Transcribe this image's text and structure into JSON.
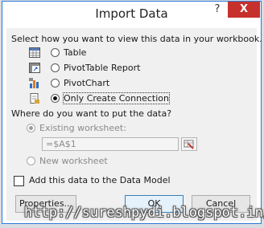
{
  "window": {
    "title": "Import Data",
    "help_label": "?",
    "close_label": "X"
  },
  "view_section": {
    "prompt": "Select how you want to view this data in your workbook.",
    "options": [
      {
        "label": "Table",
        "icon": "table-icon",
        "selected": false
      },
      {
        "label": "PivotTable Report",
        "icon": "pivottable-icon",
        "selected": false
      },
      {
        "label": "PivotChart",
        "icon": "pivotchart-icon",
        "selected": false
      },
      {
        "label": "Only Create Connection",
        "icon": "connection-icon",
        "selected": true
      }
    ]
  },
  "location_section": {
    "prompt": "Where do you want to put the data?",
    "existing_label": "Existing worksheet:",
    "existing_selected": true,
    "reference_value": "=$A$1",
    "new_label": "New worksheet",
    "enabled": false
  },
  "data_model": {
    "label": "Add this data to the Data Model",
    "checked": false
  },
  "buttons": {
    "properties": "Properties...",
    "ok": "OK",
    "cancel": "Cancel"
  },
  "watermark": "http://sureshpydi.blogspot.in/",
  "colors": {
    "title_border": "#2b79d8",
    "close_button": "#c7312b",
    "dialog_body": "#f0f0f0",
    "ref_button_icon": "#c0392b"
  }
}
